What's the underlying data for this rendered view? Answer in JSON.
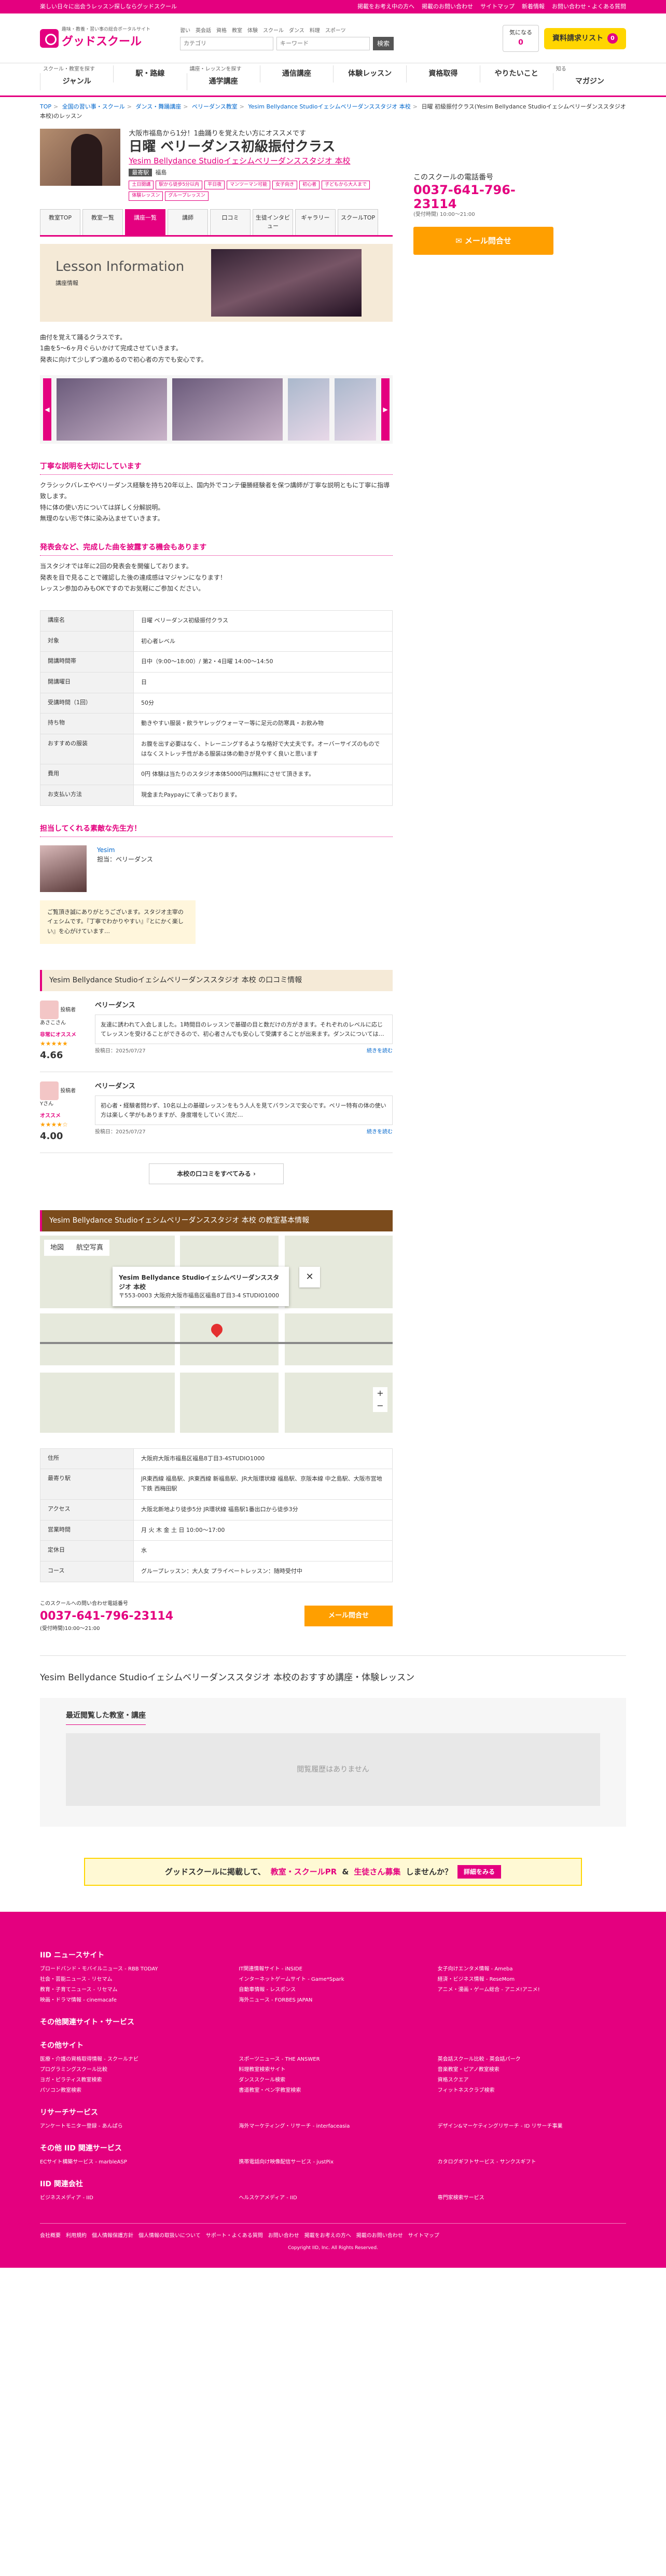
{
  "topbar": {
    "tagline": "楽しい日々に出会うレッスン探しならグッドスクール",
    "links": [
      "掲載をお考え中の方へ",
      "掲載のお問い合わせ",
      "サイトマップ",
      "新着情報",
      "お問い合わせ・よくある質問"
    ]
  },
  "header": {
    "logo_sub": "趣味・教養・習い事の総合ポータルサイト",
    "logo": "グッドスクール",
    "search_cats": [
      "習い",
      "英会話",
      "資格",
      "教室",
      "体験",
      "スクール",
      "ダンス",
      "料理",
      "スポーツ"
    ],
    "search_placeholder_1": "カテゴリ",
    "search_placeholder_2": "キーワード",
    "search_btn": "検索",
    "fav_label": "気になる",
    "fav_count": "0",
    "req_label": "資料請求リスト",
    "req_count": "0"
  },
  "gnav": [
    {
      "s": "スクール・教室を探す",
      "l": "ジャンル"
    },
    {
      "s": "",
      "l": "駅・路線"
    },
    {
      "s": "講座・レッスンを探す",
      "l": "通学講座"
    },
    {
      "s": "",
      "l": "通信講座"
    },
    {
      "s": "",
      "l": "体験レッスン"
    },
    {
      "s": "",
      "l": "資格取得"
    },
    {
      "s": "",
      "l": "やりたいこと"
    },
    {
      "s": "知る",
      "l": "マガジン"
    }
  ],
  "breadcrumb": [
    "TOP",
    "全国の習い事・スクール",
    "ダンス・舞踊講座",
    "ベリーダンス教室",
    "Yesim Bellydance Studioイェシムベリーダンススタジオ 本校"
  ],
  "breadcrumb_current": "日曜 初級振付クラス(Yesim Bellydance Studioイェシムベリーダンススタジオ本校)のレッスン",
  "course": {
    "sub": "大阪市福島から1分！1曲踊りを覚えたい方にオススメです",
    "title": "日曜 ベリーダンス初級振付クラス",
    "school": "Yesim Bellydance Studioイェシムベリーダンススタジオ 本校",
    "area_label": "最寄駅",
    "area": "福島",
    "tags": [
      "土日開講",
      "駅から徒歩5分以内",
      "平日夜",
      "マンツーマン可能",
      "女子向き",
      "初心者",
      "子どもから大人まで",
      "体験レッスン",
      "グループレッスン"
    ]
  },
  "tabs": [
    "教室TOP",
    "教室一覧",
    "講座一覧",
    "講師",
    "口コミ",
    "生徒インタビュー",
    "ギャラリー",
    "スクールTOP"
  ],
  "lesson": {
    "en": "Lesson Information",
    "jp": "講座情報",
    "intro": [
      "曲付を覚えて踊るクラスです。",
      "1曲を5〜6ヶ月ぐらいかけて完成させていきます。",
      "発表に向けて少しずつ進めるので初心者の方でも安心です。"
    ]
  },
  "sections": [
    {
      "h": "丁寧な説明を大切にしています",
      "t": [
        "クラシックバレエやベリーダンス経験を持ち20年以上、国内外でコンテ優勝経験者を保つ講師が丁寧な説明ともに丁寧に指導致します。",
        "特に体の使い方については詳しく分解説明。",
        "無理のない形で体に染み込ませていきます。"
      ]
    },
    {
      "h": "発表会など、完成した曲を披露する機会もあります",
      "t": [
        "当スタジオでは年に2回の発表会を開催しております。",
        "発表を目で見ることで確認した後の達成感はマジャンになります！",
        "レッスン参加のみもOKですのでお気軽にご参加ください。"
      ]
    }
  ],
  "details": [
    {
      "k": "講座名",
      "v": "日曜 ベリーダンス初級振付クラス"
    },
    {
      "k": "対象",
      "v": "初心者レベル"
    },
    {
      "k": "開講時間帯",
      "v": "日中（9:00〜18:00）/ 第2・4日曜 14:00〜14:50"
    },
    {
      "k": "開講曜日",
      "v": "日"
    },
    {
      "k": "受講時間（1回）",
      "v": "50分"
    },
    {
      "k": "持ち物",
      "v": "動きやすい服装・飲ラヤレッグウォーマー等に足元の防寒具・お飲み物"
    },
    {
      "k": "おすすめの服装",
      "v": "お腹を出す必要はなく、トレーニングするような格好で大丈夫です。オーバーサイズのものではなくストレッチ性がある服装は体の動きが見やすく良いと思います"
    },
    {
      "k": "費用",
      "v": "0円 体験は当たりのスタジオ本体5000円は無料にさせて頂きます。"
    },
    {
      "k": "お支払い方法",
      "v": "現金またPaypayにて承っております。"
    }
  ],
  "teacher": {
    "h": "担当してくれる素敵な先生方！",
    "name": "Yesim",
    "role": "担当：ベリーダンス",
    "msg": "ご覧頂き誠にありがとうございます。スタジオ主宰のイェシムです。『丁寧でわかりやすい』『とにかく楽しい』を心がけています…"
  },
  "reviews_head": "Yesim Bellydance Studioイェシムベリーダンススタジオ 本校 の口コミ情報",
  "reviews": [
    {
      "who": "投稿者",
      "name": "あさこさん",
      "badge": "非常にオススメ",
      "stars": "★★★★★",
      "score": "4.66",
      "title": "ベリーダンス",
      "body": "友達に誘われて入会しました。1時間目のレッスンで基礎の目と数だけの方がきます。それぞれのレベルに応じてレッスンを受けることができるので、初心者さんでも安心して受講することが出来ます。ダンスについては…",
      "date": "投稿日：2025/07/27",
      "more": "続きを読む"
    },
    {
      "who": "投稿者",
      "name": "Yさん",
      "badge": "オススメ",
      "stars": "★★★★☆",
      "score": "4.00",
      "title": "ベリーダンス",
      "body": "初心者・経験者問わず、10名以上の基礎レッスンをもう人人を見てバランスで安心です。ベリー特有の体の使い方は楽しく学がもありますが、身度増をしていく流だ…",
      "date": "投稿日：2025/07/27",
      "more": "続きを読む"
    }
  ],
  "all_reviews": "本校の口コミをすべてみる",
  "map_head": "Yesim Bellydance Studioイェシムベリーダンススタジオ 本校 の教室基本情報",
  "map": {
    "tab1": "地図",
    "tab2": "航空写真",
    "name": "Yesim Bellydance Studioイェシムベリーダンススタジオ 本校",
    "addr": "〒553-0003 大阪府大阪市福島区福島8丁目3-4 STUDIO1000",
    "close": "✕",
    "zoom_in": "+",
    "zoom_out": "−"
  },
  "info": [
    {
      "k": "住所",
      "v": "大阪府大阪市福島区福島8丁目3-4STUDIO1000"
    },
    {
      "k": "最寄り駅",
      "v": "JR東西線 福島駅、JR東西線 新福島駅、JR大阪環状線 福島駅、京阪本線 中之島駅、大阪市営地下鉄 西梅田駅"
    },
    {
      "k": "アクセス",
      "v": "大阪北新地より徒歩5分 JR環状線 福島駅1番出口から徒歩3分"
    },
    {
      "k": "営業時間",
      "v": "月 火 木 金 土 日 10:00〜17:00"
    },
    {
      "k": "定休日",
      "v": "水"
    },
    {
      "k": "コース",
      "v": "グループレッスン：大人女 プライベートレッスン：随時受付中"
    }
  ],
  "contact": {
    "lbl": "このスクールへの問い合わせ電話番号",
    "num": "0037-641-796-23114",
    "hrs": "(受付時間)10:00〜21:00",
    "btn": "メール問合せ"
  },
  "side": {
    "lbl": "このスクールの電話番号",
    "num": "0037-641-796-23114",
    "hrs": "(受付時間) 10:00〜21:00",
    "btn": "メール問合せ"
  },
  "rec_title": "Yesim Bellydance Studioイェシムベリーダンススタジオ 本校のおすすめ講座・体験レッスン",
  "recent_title": "最近閲覧した教室・講座",
  "recent_empty": "閲覧履歴はありません",
  "banner": {
    "a": "グッドスクールに掲載して、",
    "b": "教室・スクールPR",
    "c": "&",
    "d": "生徒さん募集",
    "e": "しませんか？",
    "go": "詳細をみる"
  },
  "footer": {
    "h1": "IID ニュースサイト",
    "g1": [
      "ブロードバンド・モバイルニュース - RBB TODAY",
      "IT関連情報サイト - iNSIDE",
      "女子向けエンタメ情報 - Ameba",
      "社会・芸能ニュース - リセマム",
      "インターネットゲームサイト - Game*Spark",
      "経済・ビジネス情報 - ReseMom",
      "教育・子育てニュース - リセマム",
      "自動車情報 - レスポンス",
      "アニメ・漫画・ゲーム総合 - アニメ!アニメ!",
      "映画・ドラマ情報 - cinemacafe",
      "海外ニュース - FORBES JAPAN"
    ],
    "h2": "その他関連サイト・サービス",
    "h3": "その他サイト",
    "g3": [
      "医療・介護の資格取得情報 - スクールナビ",
      "スポーツニュース - THE ANSWER",
      "英会話スクール比較 - 英会話パーク",
      "プログラミングスクール比較",
      "料理教室検索サイト",
      "音楽教室・ピアノ教室検索",
      "ヨガ・ピラティス教室検索",
      "ダンススクール検索",
      "資格スクエア",
      "パソコン教室検索",
      "書道教室・ペン字教室検索",
      "フィットネスクラブ検索"
    ],
    "h4": "リサーチサービス",
    "g4": [
      "アンケートモニター登録 - あんぱら",
      "海外マーケティング・リサーチ - interfaceasia",
      "デザイン&マーケティングリサーチ - ID リサーチ事業"
    ],
    "h5": "その他 IID 関連サービス",
    "g5": [
      "ECサイト構築サービス - marbleASP",
      "携帯電話向け映像配信サービス - justPix",
      "カタログギフトサービス - サンクスギフト"
    ],
    "h6": "IID 関連会社",
    "g6": [
      "ビジネスメディア - IID",
      "ヘルスケアメディア - IID",
      "専門家検索サービス"
    ],
    "bottom": [
      "会社概要",
      "利用規約",
      "個人情報保護方針",
      "個人情報の取扱いについて",
      "サポート・よくある質問",
      "お問い合わせ",
      "掲載をお考えの方へ",
      "掲載のお問い合わせ",
      "サイトマップ"
    ],
    "copy": "Copyright IID, Inc. All Rights Reserved."
  }
}
